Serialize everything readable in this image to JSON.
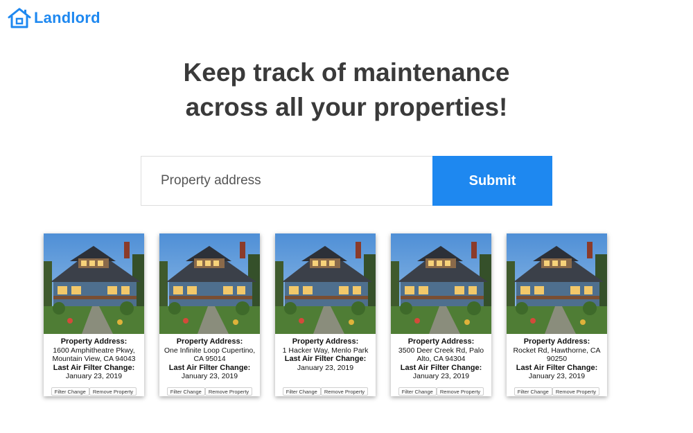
{
  "brand": {
    "name": "Landlord",
    "icon": "house-icon",
    "color": "#1e88f0"
  },
  "headline": {
    "line1": "Keep track of maintenance",
    "line2": "across all your properties!"
  },
  "search": {
    "placeholder": "Property address",
    "value": "",
    "submit_label": "Submit"
  },
  "labels": {
    "address": "Property Address:",
    "filter": "Last Air Filter Change:",
    "filter_button": "Filter Change",
    "remove_button": "Remove Property"
  },
  "properties": [
    {
      "address": "1600 Amphitheatre Pkwy, Mountain View, CA 94043",
      "filter_date": "January 23, 2019"
    },
    {
      "address": "One Infinite Loop Cupertino, CA 95014",
      "filter_date": "January 23, 2019"
    },
    {
      "address": "1 Hacker Way, Menlo Park",
      "filter_date": "January 23, 2019"
    },
    {
      "address": "3500 Deer Creek Rd, Palo Alto, CA 94304",
      "filter_date": "January 23, 2019"
    },
    {
      "address": "Rocket Rd, Hawthorne, CA 90250",
      "filter_date": "January 23, 2019"
    }
  ]
}
